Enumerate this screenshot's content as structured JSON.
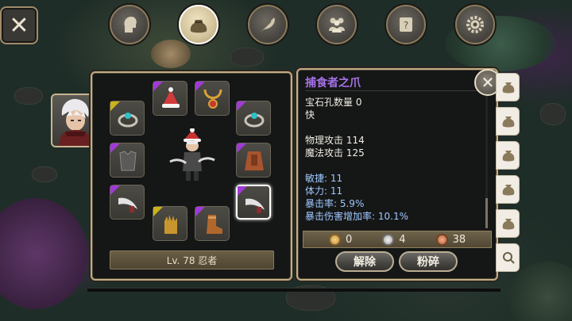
{
  "top_tabs": [
    {
      "name": "character-tab",
      "icon": "head-icon",
      "active": false
    },
    {
      "name": "inventory-tab",
      "icon": "bag-icon",
      "active": true
    },
    {
      "name": "skills-tab",
      "icon": "feather-icon",
      "active": false
    },
    {
      "name": "party-tab",
      "icon": "group-icon",
      "active": false
    },
    {
      "name": "quest-tab",
      "icon": "scroll-icon",
      "active": false
    },
    {
      "name": "settings-tab",
      "icon": "gear-icon",
      "active": false
    }
  ],
  "character": {
    "level_class": "Lv. 78 忍者"
  },
  "equipment_slots": [
    {
      "name": "helmet-slot",
      "icon": "hat-icon",
      "rarity_color": "#a03ad6"
    },
    {
      "name": "necklace-slot",
      "icon": "necklace-icon",
      "rarity_color": "#a03ad6"
    },
    {
      "name": "ring-left-slot",
      "icon": "ring-icon",
      "rarity_color": "#c9b21c"
    },
    {
      "name": "ring-right-slot",
      "icon": "ring-icon",
      "rarity_color": "#a03ad6"
    },
    {
      "name": "armor-slot",
      "icon": "armor-icon",
      "rarity_color": "#a03ad6"
    },
    {
      "name": "cloak-slot",
      "icon": "cloak-icon",
      "rarity_color": "#a03ad6"
    },
    {
      "name": "left-weapon-slot",
      "icon": "claw-icon",
      "rarity_color": "#a03ad6"
    },
    {
      "name": "right-weapon-slot",
      "icon": "claw-icon",
      "rarity_color": "#a03ad6",
      "selected": true
    },
    {
      "name": "gloves-slot",
      "icon": "glove-icon",
      "rarity_color": "#c9b21c"
    },
    {
      "name": "boots-slot",
      "icon": "boot-icon",
      "rarity_color": "#a03ad6"
    }
  ],
  "item": {
    "name": "捕食者之爪",
    "name_color": "#a672e8",
    "socket_count": "宝石孔数量 0",
    "speed": "快",
    "phys_attack": "物理攻击 114",
    "magic_attack": "魔法攻击 125",
    "agility": "敏捷: 11",
    "stamina": "体力: 11",
    "crit_rate": "暴击率: 5.9%",
    "crit_damage": "暴击伤害增加率: 10.1%"
  },
  "currency": {
    "gold": "0",
    "silver": "4",
    "bronze": "38"
  },
  "buttons": {
    "unequip": "解除",
    "shatter": "粉碎"
  },
  "colors": {
    "epic": "#a03ad6",
    "rare": "#c9b21c",
    "stat_blue": "#9fc8ff",
    "frame_gold": "#c4ad83"
  }
}
